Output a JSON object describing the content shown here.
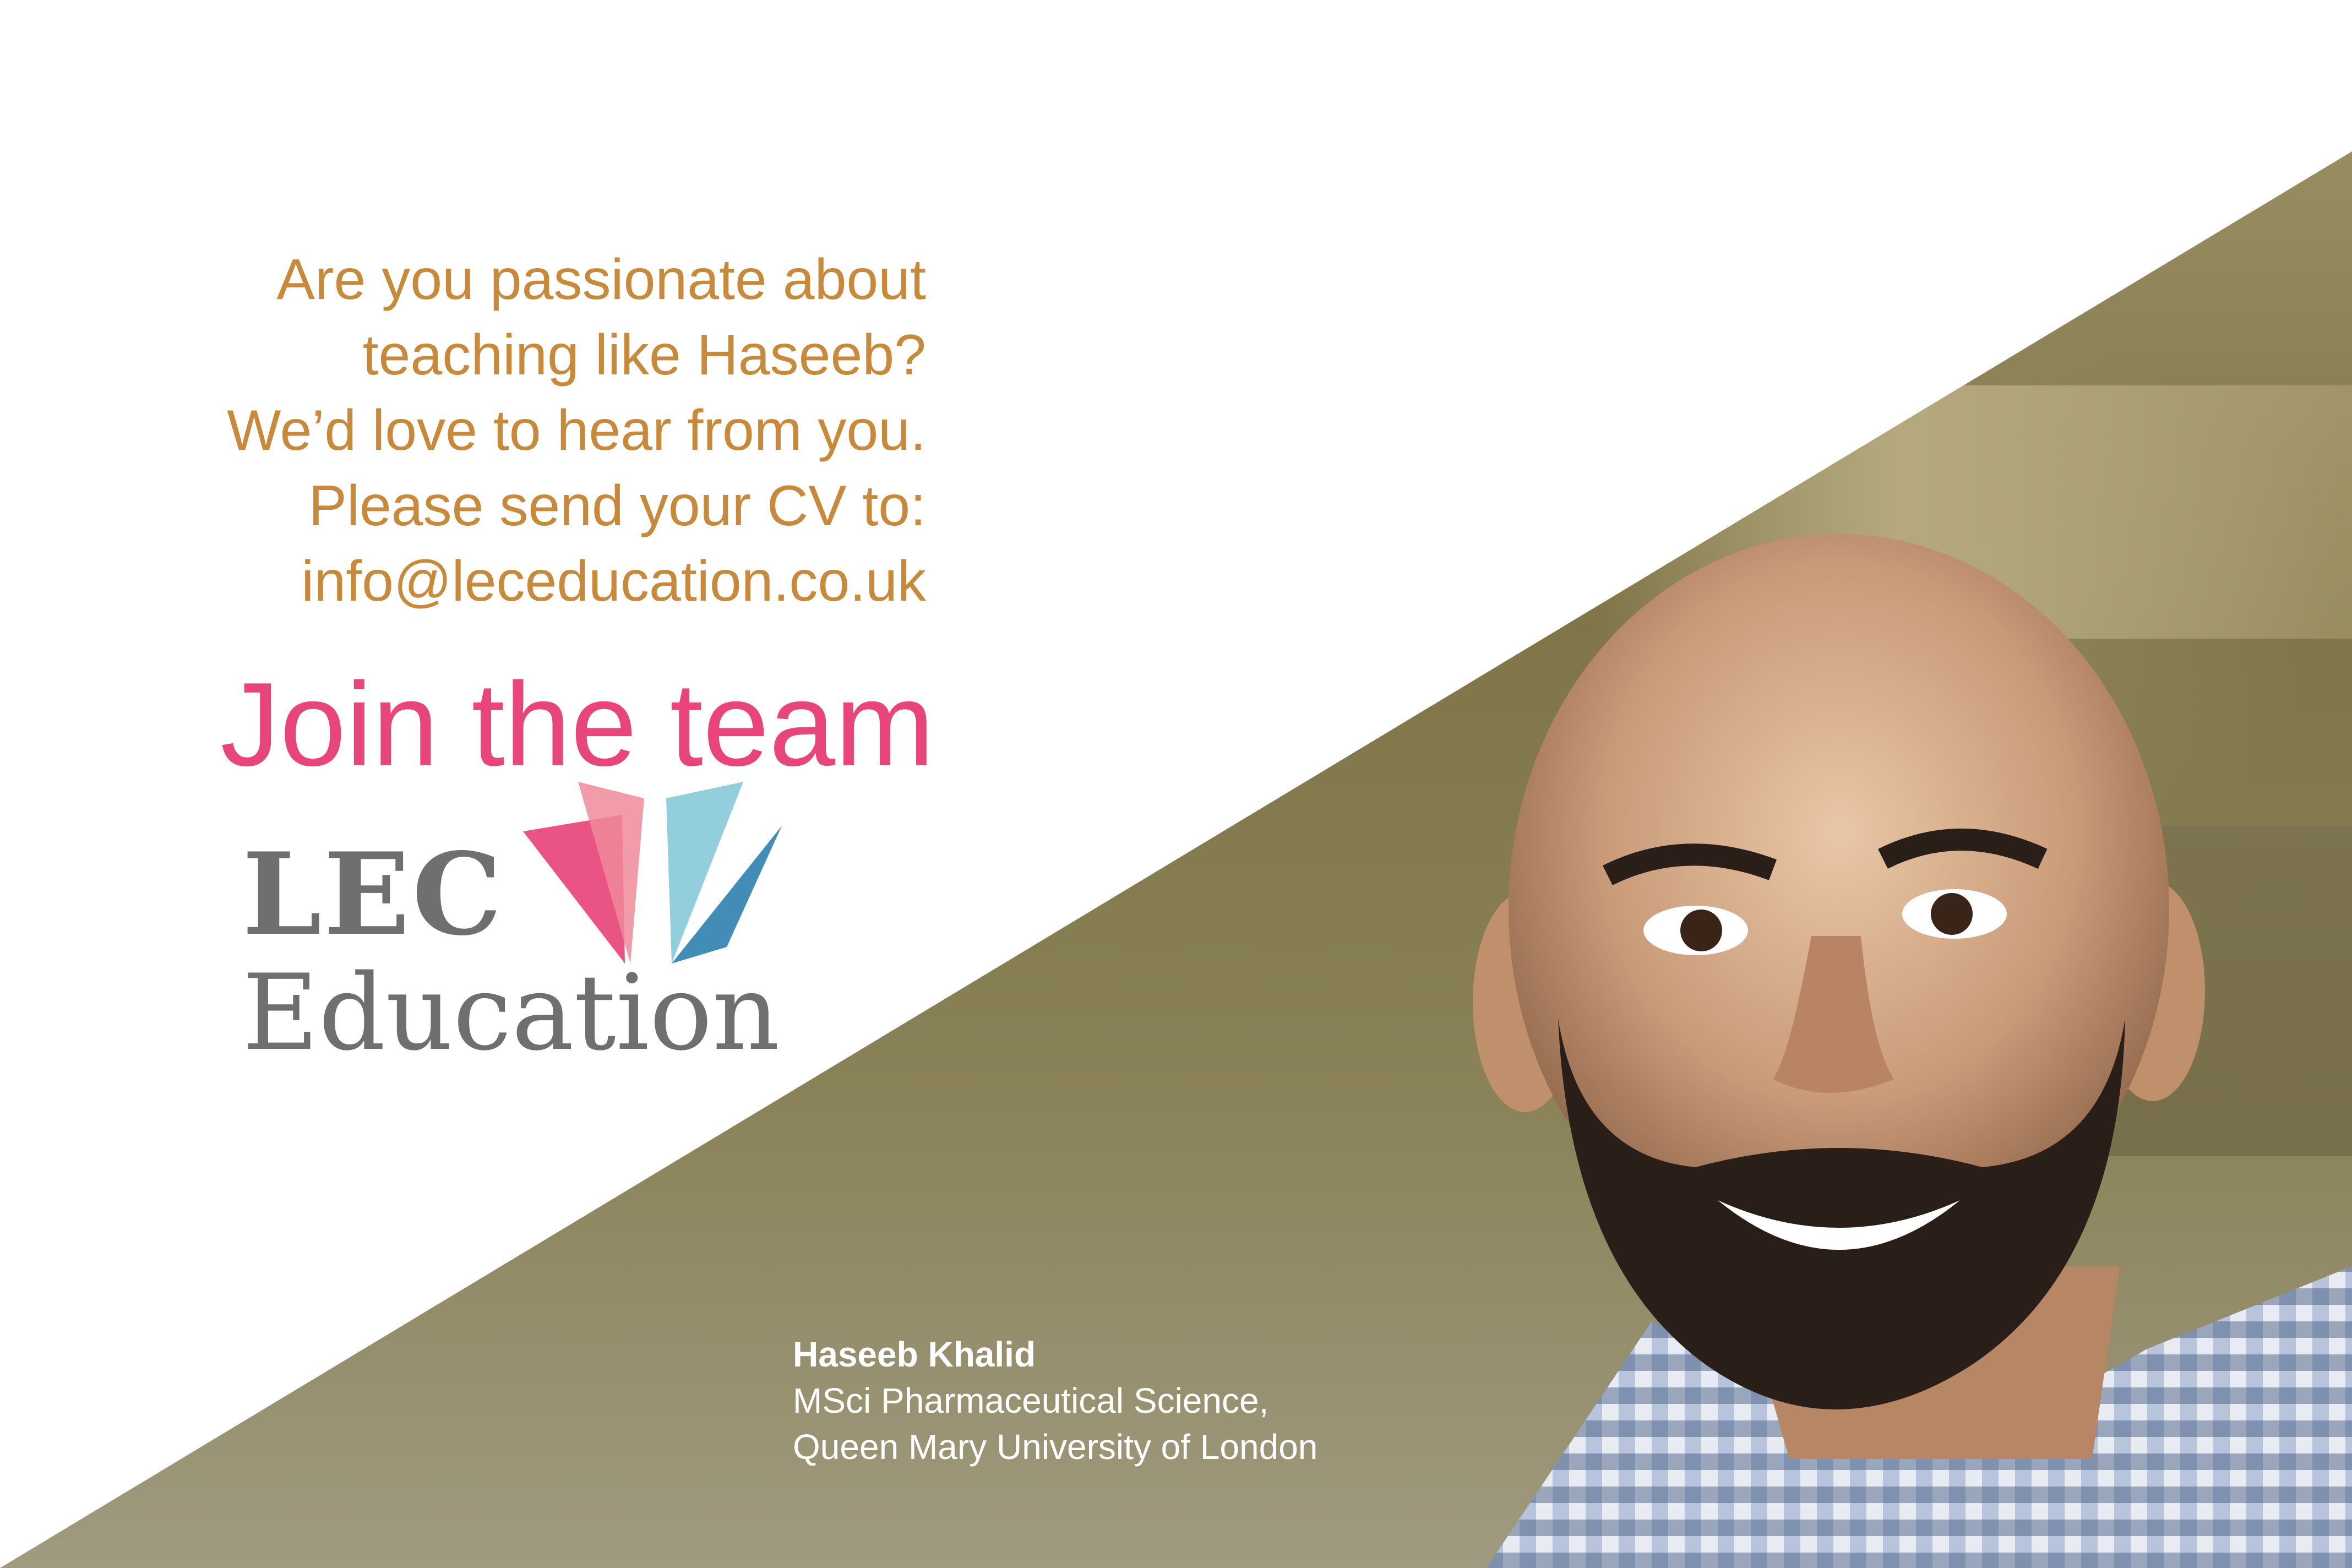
{
  "pitch": {
    "lines": [
      "Are you passionate about",
      "teaching like Haseeb?",
      "We’d love to hear from you.",
      "Please send your CV to:",
      "info@leceducation.co.uk"
    ]
  },
  "headline": "Join the team",
  "logo": {
    "line1": "LEC",
    "line2": "Education",
    "colors": {
      "text": "#6f6f72",
      "pink": "#e8457a",
      "rose": "#f08a9a",
      "teal": "#7fc6d6",
      "blue": "#2e7fb0"
    }
  },
  "caption": {
    "name": "Haseeb Khalid",
    "line1": "MSci Pharmaceutical Science,",
    "line2": "Queen Mary University of London"
  },
  "colors": {
    "pitch_text": "#c8893a",
    "headline": "#e8457a",
    "caption": "#ffffff"
  }
}
